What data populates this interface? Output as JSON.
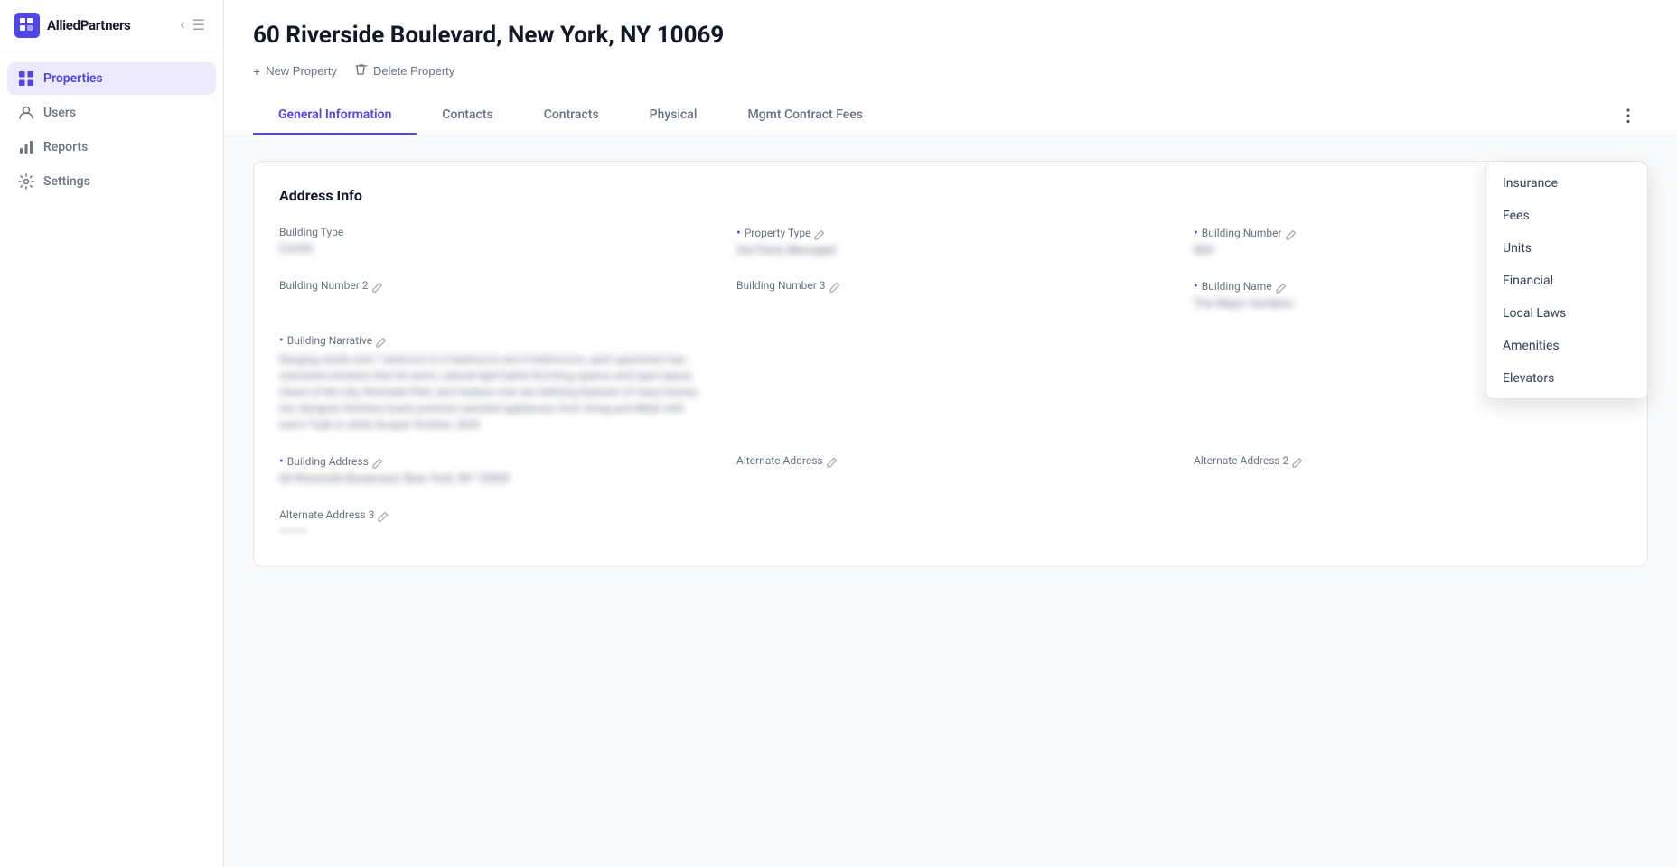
{
  "app": {
    "name": "AlliedPartners",
    "logo_symbol": "⊞"
  },
  "sidebar": {
    "collapse_icon": "‹",
    "menu_icon": "☰",
    "nav_items": [
      {
        "id": "properties",
        "label": "Properties",
        "icon": "grid",
        "active": true
      },
      {
        "id": "users",
        "label": "Users",
        "icon": "user",
        "active": false
      },
      {
        "id": "reports",
        "label": "Reports",
        "icon": "bar-chart",
        "active": false
      },
      {
        "id": "settings",
        "label": "Settings",
        "icon": "gear",
        "active": false
      }
    ]
  },
  "header": {
    "title": "60 Riverside Boulevard, New York, NY 10069",
    "actions": [
      {
        "id": "new-property",
        "label": "New Property",
        "icon": "+"
      },
      {
        "id": "delete-property",
        "label": "Delete Property",
        "icon": "🗑"
      }
    ]
  },
  "tabs": [
    {
      "id": "general-information",
      "label": "General Information",
      "active": true
    },
    {
      "id": "contacts",
      "label": "Contacts",
      "active": false
    },
    {
      "id": "contracts",
      "label": "Contracts",
      "active": false
    },
    {
      "id": "physical",
      "label": "Physical",
      "active": false
    },
    {
      "id": "mgmt-contract-fees",
      "label": "Mgmt Contract Fees",
      "active": false
    }
  ],
  "more_menu": {
    "items": [
      {
        "id": "insurance",
        "label": "Insurance"
      },
      {
        "id": "fees",
        "label": "Fees"
      },
      {
        "id": "units",
        "label": "Units"
      },
      {
        "id": "financial",
        "label": "Financial"
      },
      {
        "id": "local-laws",
        "label": "Local Laws"
      },
      {
        "id": "amenities",
        "label": "Amenities"
      },
      {
        "id": "elevators",
        "label": "Elevators"
      }
    ]
  },
  "address_info": {
    "section_title": "Address Info",
    "fields": {
      "building_type": {
        "label": "Building Type",
        "value": "Condo",
        "required": false
      },
      "property_type": {
        "label": "Property Type",
        "value": "3rd Party Managed",
        "required": true
      },
      "building_number": {
        "label": "Building Number",
        "value": "860",
        "required": true
      },
      "building_number_2": {
        "label": "Building Number 2",
        "value": "",
        "required": false
      },
      "building_number_3": {
        "label": "Building Number 3",
        "value": "",
        "required": false
      },
      "building_name": {
        "label": "Building Name",
        "value": "The Major Gardens",
        "required": true
      },
      "building_narrative": {
        "label": "Building Narrative",
        "value": "Ranging studio and 1 bedroom to 4 bedrooms and 4 bathrooms, each apartment has oversized windows that let warm, natural light bathe the living spaces and open layout. Views of the city, Riverside Park, and Hudson river are defining features of many homes. Our designer kitchens boast premium paneled appliances from Smeg and Miele with warm Teak or white lacquer finishes. Both",
        "required": true
      },
      "building_address": {
        "label": "Building Address",
        "value": "60 Riverside Boulevard, New York, NY 10069",
        "required": true
      },
      "alternate_address": {
        "label": "Alternate Address",
        "value": "",
        "required": false
      },
      "alternate_address_2": {
        "label": "Alternate Address 2",
        "value": "",
        "required": false
      },
      "alternate_address_3": {
        "label": "Alternate Address 3",
        "value": "",
        "required": false
      }
    }
  }
}
